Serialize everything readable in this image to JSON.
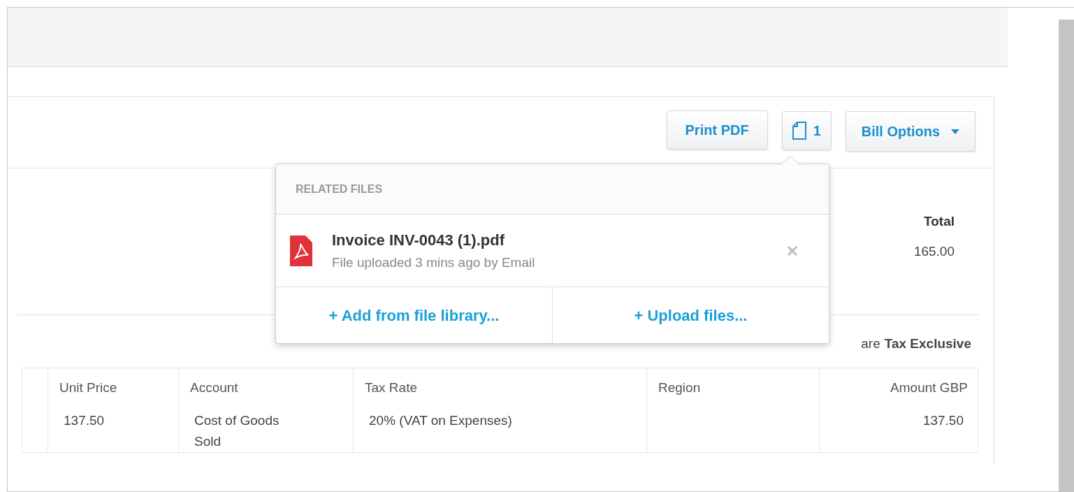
{
  "toolbar": {
    "buttons": [
      {
        "kind": "text",
        "label": "Print PDF"
      },
      {
        "kind": "files",
        "label": "1"
      },
      {
        "kind": "menu",
        "label": "Bill Options"
      }
    ]
  },
  "related_files": {
    "title": "RELATED FILES",
    "files": [
      {
        "name": "Invoice INV-0043 (1).pdf",
        "meta": "File uploaded 3 mins ago by Email"
      }
    ],
    "actions": [
      "+ Add from file library...",
      "+ Upload files..."
    ]
  },
  "totals": {
    "label": "Total",
    "value": "165.00"
  },
  "tax_note": {
    "prefix": "are",
    "mode": "Tax Exclusive"
  },
  "table": {
    "columns": [
      "Unit Price",
      "Account",
      "Tax Rate",
      "Region",
      "Amount GBP"
    ],
    "rows": [
      [
        "137.50",
        "Cost of Goods Sold",
        "20% (VAT on Expenses)",
        "",
        "137.50"
      ]
    ]
  }
}
